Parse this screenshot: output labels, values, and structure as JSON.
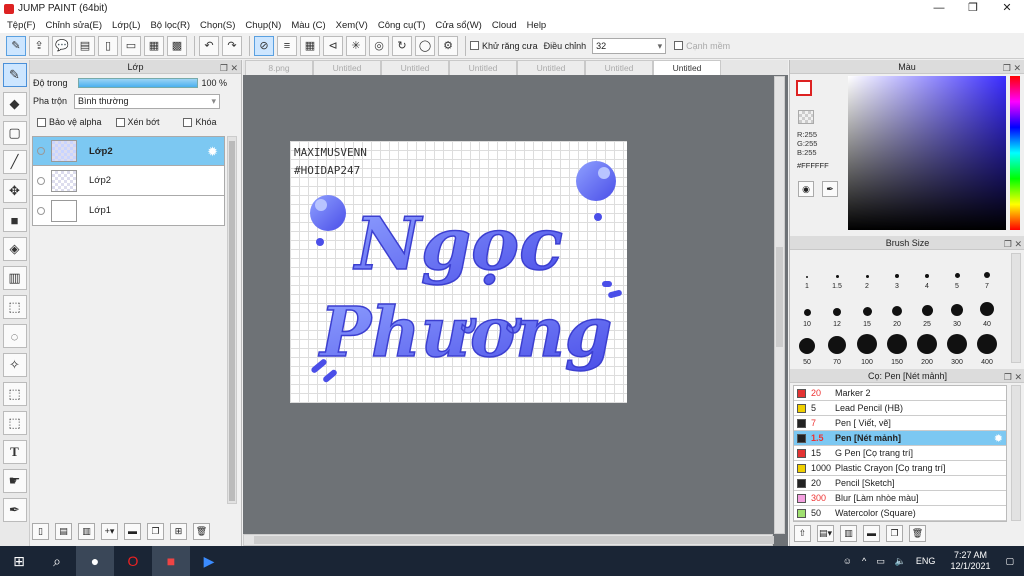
{
  "window": {
    "title": "JUMP PAINT (64bit)",
    "min": "—",
    "max": "❐",
    "close": "✕"
  },
  "menu": [
    "Tệp(F)",
    "Chỉnh sửa(E)",
    "Lớp(L)",
    "Bộ lọc(R)",
    "Chọn(S)",
    "Chụp(N)",
    "Màu (C)",
    "Xem(V)",
    "Công cụ(T)",
    "Cửa sổ(W)",
    "Cloud",
    "Help"
  ],
  "toolbar": {
    "antialias_label": "Khử răng cưa",
    "adjust_label": "Điều chỉnh",
    "adjust_value": "32",
    "snap_label": "Cạnh mềm"
  },
  "layer_panel": {
    "title": "Lớp",
    "opacity_label": "Độ trong",
    "opacity_value": "100 %",
    "opacity": 1.0,
    "blend_label": "Pha trộn",
    "blend_value": "Bình thường",
    "protect_alpha": "Bảo vệ alpha",
    "clip": "Xén bớt",
    "lock": "Khóa",
    "layers": [
      {
        "name": "Lớp2",
        "selected": true
      },
      {
        "name": "Lớp2",
        "selected": false
      },
      {
        "name": "Lớp1",
        "selected": false
      }
    ]
  },
  "tabs": [
    "8.png",
    "Untitled",
    "Untitled",
    "Untitled",
    "Untitled",
    "Untitled",
    "Untitled"
  ],
  "canvas": {
    "text1": "MAXIMUSVENN",
    "text2": "#HOIDAP247",
    "word1": "Ngọc",
    "word2": "Phương"
  },
  "color_panel": {
    "title": "Màu",
    "r": "R:255",
    "g": "G:255",
    "b": "B:255",
    "hex": "#FFFFFF",
    "fg": "#FFFFFF",
    "accent": "#D22222"
  },
  "brush_panel": {
    "title": "Brush Size",
    "sizes": [
      "1",
      "1.5",
      "2",
      "3",
      "4",
      "5",
      "7",
      "10",
      "12",
      "15",
      "20",
      "25",
      "30",
      "40",
      "50",
      "70",
      "100",
      "150",
      "200",
      "300",
      "400"
    ]
  },
  "pen_panel": {
    "title": "Cọ: Pen [Nét mảnh]",
    "pens": [
      {
        "size": "20",
        "name": "Marker 2",
        "color": "#e33333",
        "red": true
      },
      {
        "size": "5",
        "name": "Lead Pencil (HB)",
        "color": "#f0d000",
        "red": false
      },
      {
        "size": "7",
        "name": "Pen [ Viết, vẽ]",
        "color": "#222222",
        "red": true
      },
      {
        "size": "1.5",
        "name": "Pen [Nét mảnh]",
        "color": "#222222",
        "red": true,
        "selected": true
      },
      {
        "size": "15",
        "name": "G Pen [Cọ trang trí]",
        "color": "#e33333",
        "red": false
      },
      {
        "size": "1000",
        "name": "Plastic Crayon [Cọ trang trí]",
        "color": "#f0d000",
        "red": false
      },
      {
        "size": "20",
        "name": "Pencil [Sketch]",
        "color": "#222222",
        "red": false
      },
      {
        "size": "300",
        "name": "Blur [Làm nhòe màu]",
        "color": "#f4a0e0",
        "red": true
      },
      {
        "size": "50",
        "name": "Watercolor (Square)",
        "color": "#a0e070",
        "red": false
      }
    ]
  },
  "taskbar": {
    "lang": "ENG",
    "time": "7:27 AM",
    "date": "12/1/2021"
  }
}
